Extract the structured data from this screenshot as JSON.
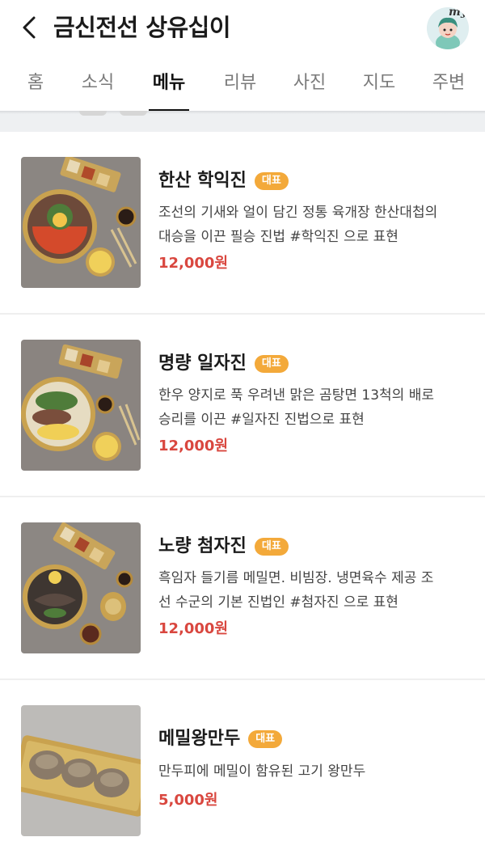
{
  "header": {
    "title": "금신전선 상유십이",
    "avatar_label": "my"
  },
  "tabs": [
    "홈",
    "소식",
    "메뉴",
    "리뷰",
    "사진",
    "지도",
    "주변"
  ],
  "active_tab": "메뉴",
  "menu": [
    {
      "name": "한산 학익진",
      "badge": "대표",
      "desc_lines": [
        "조선의 기새와 얼이 담긴 정통 육개장 한산대첩의",
        "대승을 이끈 필승 진법 #학익진 으로 표현"
      ],
      "price": "12,000원"
    },
    {
      "name": "명량 일자진",
      "badge": "대표",
      "desc_lines": [
        "한우 양지로 푹 우려낸 맑은 곰탕면 13척의 배로",
        "승리를 이끈 #일자진 진법으로 표현"
      ],
      "price": "12,000원"
    },
    {
      "name": "노량 첨자진",
      "badge": "대표",
      "desc_lines": [
        "흑임자 들기름 메밀면. 비빔장. 냉면육수 제공 조",
        "선 수군의 기본 진법인 #첨자진 으로 표현"
      ],
      "price": "12,000원"
    },
    {
      "name": "메밀왕만두",
      "badge": "대표",
      "desc_lines": [
        "만두피에 메밀이 함유된 고기 왕만두"
      ],
      "price": "5,000원"
    }
  ],
  "colors": {
    "badge": "#f3a93a",
    "price": "#d9473f",
    "active_tab": "#111111"
  },
  "icons": {
    "back": "chevron-left-icon",
    "avatar": "avatar-character-icon"
  }
}
